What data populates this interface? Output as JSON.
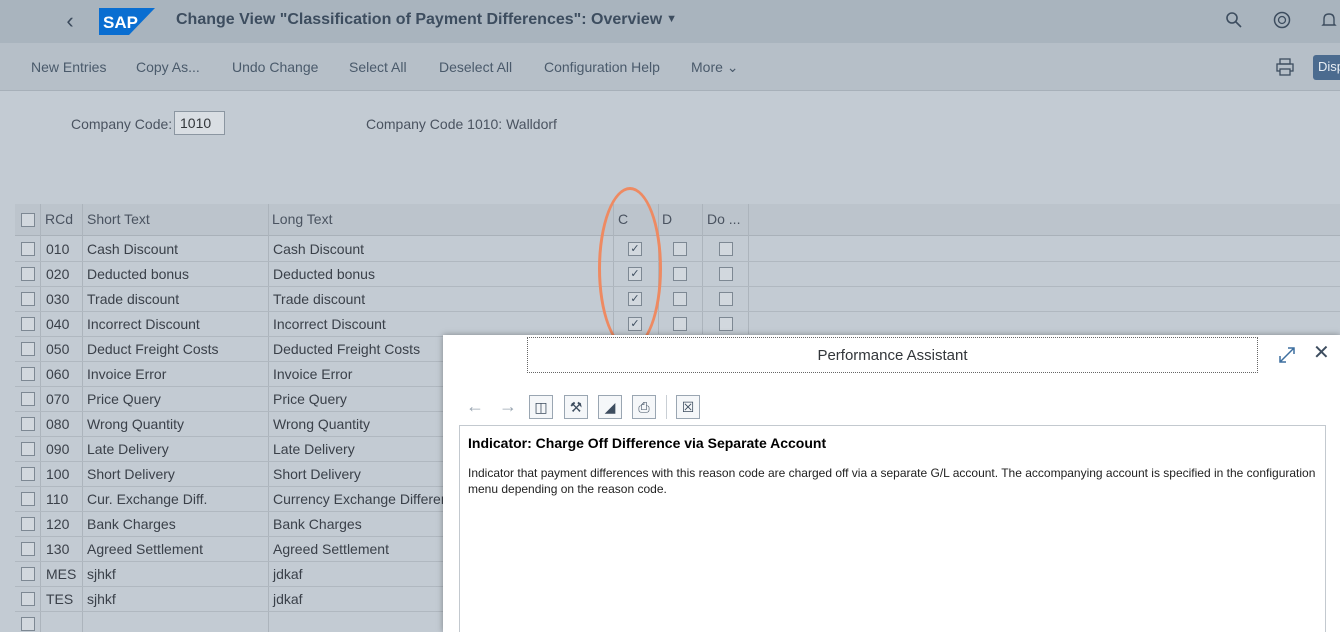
{
  "shell": {
    "title": "Change View \"Classification of Payment Differences\": Overview",
    "back_icon": "chevron-left-icon",
    "logo_text": "SAP",
    "brand_color": "#0a6ed1",
    "icons": [
      "search-icon",
      "help-icon",
      "bell-icon"
    ]
  },
  "toolbar": {
    "new_entries": "New Entries",
    "copy_as": "Copy As...",
    "undo_change": "Undo Change",
    "select_all": "Select All",
    "deselect_all": "Deselect All",
    "configuration_help": "Configuration Help",
    "more": "More",
    "display_label": "Disp"
  },
  "company": {
    "label": "Company Code:",
    "value": "1010",
    "description": "Company Code 1010: Walldorf"
  },
  "table": {
    "columns": [
      "RCd",
      "Short Text",
      "Long Text",
      "C",
      "D",
      "Do ..."
    ],
    "rows": [
      {
        "rcd": "010",
        "short": "Cash Discount",
        "long": "Cash Discount",
        "c": true,
        "d": false,
        "do": false
      },
      {
        "rcd": "020",
        "short": "Deducted bonus",
        "long": "Deducted bonus",
        "c": true,
        "d": false,
        "do": false
      },
      {
        "rcd": "030",
        "short": "Trade discount",
        "long": "Trade discount",
        "c": true,
        "d": false,
        "do": false
      },
      {
        "rcd": "040",
        "short": "Incorrect Discount",
        "long": "Incorrect Discount",
        "c": true,
        "d": false,
        "do": false
      },
      {
        "rcd": "050",
        "short": "Deduct Freight Costs",
        "long": "Deducted Freight Costs"
      },
      {
        "rcd": "060",
        "short": "Invoice Error",
        "long": "Invoice Error"
      },
      {
        "rcd": "070",
        "short": "Price Query",
        "long": "Price Query"
      },
      {
        "rcd": "080",
        "short": "Wrong Quantity",
        "long": "Wrong Quantity"
      },
      {
        "rcd": "090",
        "short": "Late Delivery",
        "long": "Late Delivery"
      },
      {
        "rcd": "100",
        "short": "Short Delivery",
        "long": "Short Delivery"
      },
      {
        "rcd": "110",
        "short": "Cur. Exchange Diff.",
        "long": "Currency Exchange Differen"
      },
      {
        "rcd": "120",
        "short": "Bank Charges",
        "long": "Bank Charges"
      },
      {
        "rcd": "130",
        "short": "Agreed Settlement",
        "long": "Agreed Settlement"
      },
      {
        "rcd": "MES",
        "short": "sjhkf",
        "long": "jdkaf"
      },
      {
        "rcd": "TES",
        "short": "sjhkf",
        "long": "jdkaf"
      }
    ]
  },
  "assistant": {
    "header": "Performance Assistant",
    "heading": "Indicator: Charge Off Difference via Separate Account",
    "text": "Indicator that payment differences with this reason code are charged off via a separate G/L account. The accompanying account is specified in the configuration menu depending on the reason code.",
    "tools": [
      "arrow-left-icon",
      "arrow-right-icon",
      "technical-info-icon",
      "settings-icon",
      "flag-icon",
      "print-icon",
      "close-box-icon"
    ]
  }
}
